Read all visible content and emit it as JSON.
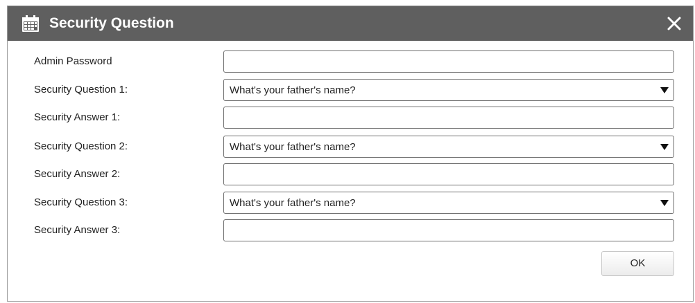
{
  "dialog": {
    "title": "Security Question",
    "title_icon": "calendar-icon",
    "close_icon": "close-icon"
  },
  "form": {
    "admin_password": {
      "label": "Admin Password",
      "value": ""
    },
    "question_1": {
      "label": "Security Question 1:",
      "selected": "What's your father's name?"
    },
    "answer_1": {
      "label": "Security Answer 1:",
      "value": ""
    },
    "question_2": {
      "label": "Security Question 2:",
      "selected": "What's your father's name?"
    },
    "answer_2": {
      "label": "Security Answer 2:",
      "value": ""
    },
    "question_3": {
      "label": "Security Question 3:",
      "selected": "What's your father's name?"
    },
    "answer_3": {
      "label": "Security Answer 3:",
      "value": ""
    }
  },
  "buttons": {
    "ok_label": "OK"
  },
  "colors": {
    "titlebar": "#5f5f5f",
    "title_text": "#ffffff"
  }
}
